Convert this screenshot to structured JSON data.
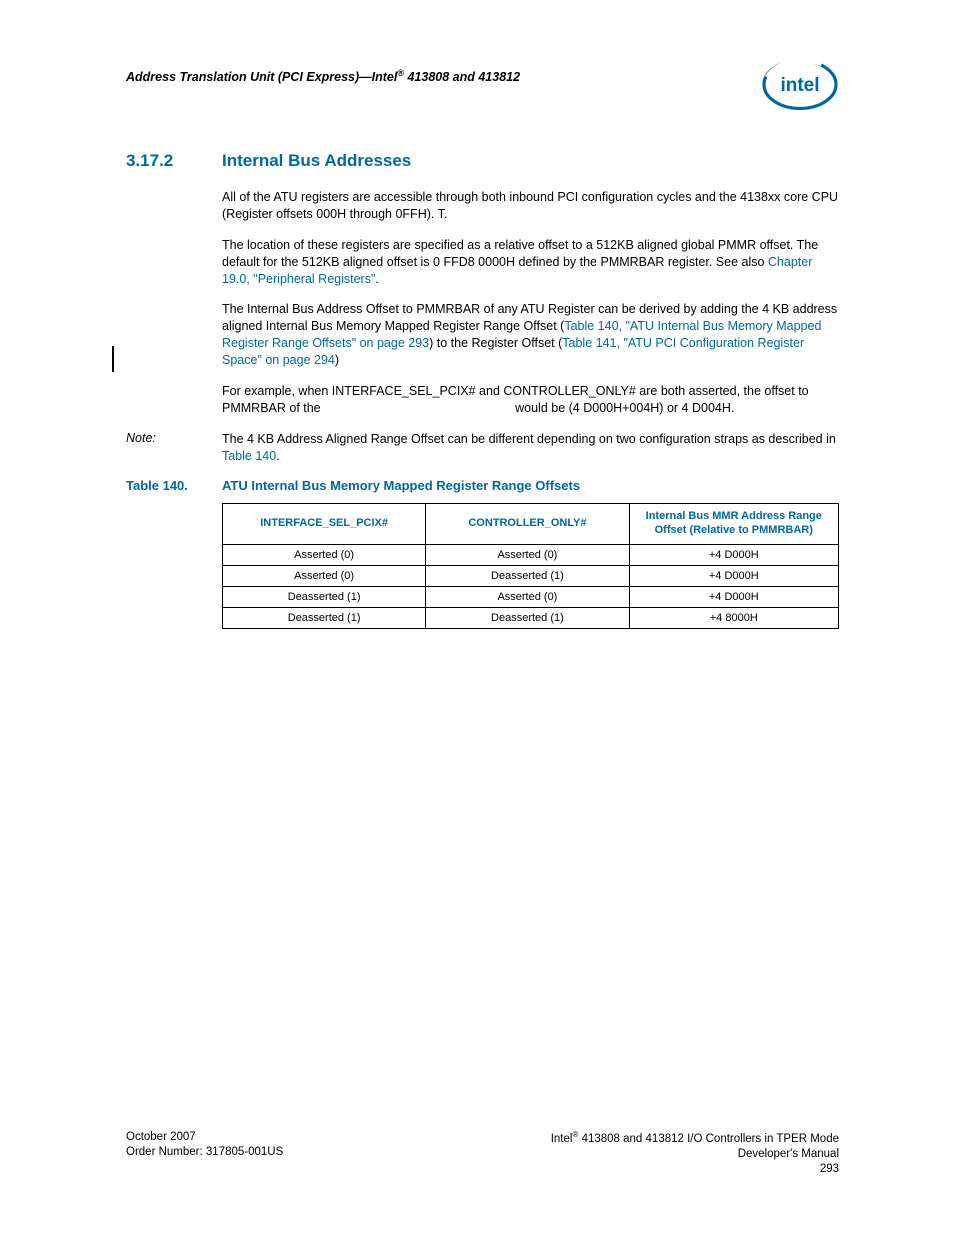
{
  "header": {
    "title_prefix": "Address Translation Unit (PCI Express)—Intel",
    "title_suffix": " 413808 and 413812",
    "reg": "®"
  },
  "section": {
    "num": "3.17.2",
    "title": "Internal Bus Addresses"
  },
  "paras": {
    "p1": "All of the ATU registers are accessible through both inbound PCI configuration cycles and the 4138xx core CPU (Register offsets 000H through 0FFH). T.",
    "p2a": "The location of these registers are specified as a relative offset to a 512KB aligned global PMMR offset. The default for the 512KB aligned offset is 0 FFD8 0000H defined by the PMMRBAR register. See also ",
    "p2_link": "Chapter 19.0, \"Peripheral Registers\"",
    "p2b": ".",
    "p3a": "The Internal Bus Address Offset to PMMRBAR of any ATU Register can be derived by adding the 4 KB address aligned Internal Bus Memory Mapped Register Range Offset (",
    "p3_link1": "Table 140, \"ATU Internal Bus Memory Mapped Register Range Offsets\" on page 293",
    "p3b": ") to the Register Offset (",
    "p3_link2": "Table 141, \"ATU PCI Configuration Register Space\" on page 294",
    "p3c": ")",
    "p4": "For example, when INTERFACE_SEL_PCIX# and CONTROLLER_ONLY# are both asserted, the offset to PMMRBAR of the                                                        would be (4 D000H+004H) or 4 D004H."
  },
  "note": {
    "label": "Note:",
    "body_a": "The 4 KB Address Aligned Range Offset can be different depending on two configuration straps as described in ",
    "body_link": "Table 140",
    "body_b": "."
  },
  "table_caption": {
    "num": "Table 140.",
    "title": "ATU Internal Bus Memory Mapped Register Range Offsets"
  },
  "table": {
    "headers": [
      "INTERFACE_SEL_PCIX#",
      "CONTROLLER_ONLY#",
      "Internal Bus MMR Address Range Offset (Relative to PMMRBAR)"
    ],
    "rows": [
      [
        "Asserted (0)",
        "Asserted (0)",
        "+4 D000H"
      ],
      [
        "Asserted (0)",
        "Deasserted (1)",
        "+4 D000H"
      ],
      [
        "Deasserted (1)",
        "Asserted (0)",
        "+4 D000H"
      ],
      [
        "Deasserted (1)",
        "Deasserted (1)",
        "+4 8000H"
      ]
    ]
  },
  "footer": {
    "left_line1": "October 2007",
    "left_line2": "Order Number: 317805-001US",
    "right_prefix": "Intel",
    "right_reg": "®",
    "right_line1_suffix": " 413808 and 413812 I/O Controllers in TPER Mode",
    "right_line2": "Developer's Manual",
    "right_line3": "293"
  }
}
